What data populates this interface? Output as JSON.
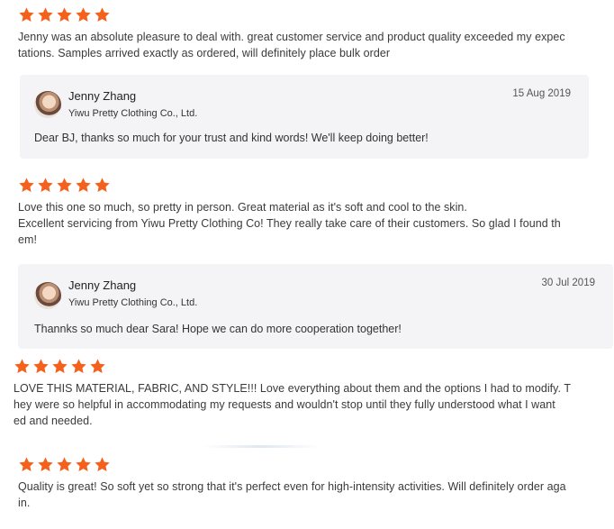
{
  "reviews": [
    {
      "rating": 5,
      "text": "Jenny was an absolute pleasure to deal with. great customer service and product quality exceeded my expec\ntations. Samples arrived exactly as ordered, will definitely place bulk order",
      "reply": {
        "name": "Jenny Zhang",
        "company": "Yiwu Pretty Clothing Co., Ltd.",
        "date": "15 Aug 2019",
        "message": "Dear BJ, thanks so much for your trust and kind words! We'll keep doing better!"
      }
    },
    {
      "rating": 5,
      "text": "Love this one so much, so pretty in person. Great material as it's soft and cool to the skin.\nExcellent servicing from Yiwu Pretty Clothing Co! They really take care of their customers. So glad I found th\nem!",
      "reply": {
        "name": "Jenny Zhang",
        "company": "Yiwu Pretty Clothing Co., Ltd.",
        "date": "30 Jul 2019",
        "message": "Thannks so much dear Sara! Hope we can do more cooperation together!"
      }
    },
    {
      "rating": 5,
      "text": "LOVE THIS MATERIAL, FABRIC, AND STYLE!!! Love everything about them and the options I had to modify. T\nhey were so helpful in accommodating my requests and wouldn't stop until they fully understood what I want\ned and needed."
    },
    {
      "rating": 5,
      "text": "Quality is great! So soft yet so strong that it's perfect even for high-intensity activities. Will definitely order aga\nin."
    }
  ],
  "colors": {
    "star": "#f4611d",
    "reply_bg": "#f4f4f6"
  },
  "icons": {
    "star": "star-icon",
    "avatar": "avatar-image"
  }
}
